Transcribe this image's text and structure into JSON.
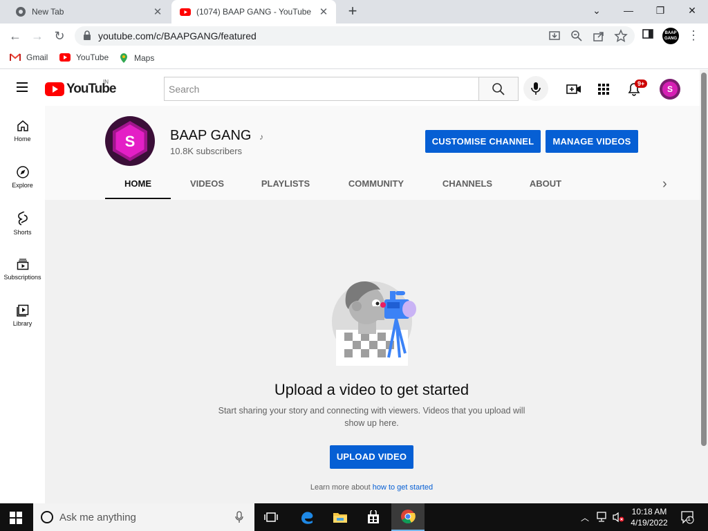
{
  "browser": {
    "tabs": [
      {
        "title": "New Tab",
        "active": false
      },
      {
        "title": "(1074) BAAP GANG - YouTube",
        "active": true
      }
    ],
    "url": "youtube.com/c/BAAPGANG/featured",
    "bookmarks": [
      {
        "label": "Gmail"
      },
      {
        "label": "YouTube"
      },
      {
        "label": "Maps"
      }
    ],
    "profile_text": "BAAP GANG"
  },
  "youtube": {
    "logo_text": "YouTube",
    "region": "IN",
    "search_placeholder": "Search",
    "notification_count": "9+",
    "account_initial": "S",
    "guide": [
      {
        "label": "Home"
      },
      {
        "label": "Explore"
      },
      {
        "label": "Shorts"
      },
      {
        "label": "Subscriptions"
      },
      {
        "label": "Library"
      }
    ],
    "channel": {
      "avatar_letter": "S",
      "name": "BAAP GANG",
      "subscribers": "10.8K subscribers",
      "customise_label": "CUSTOMISE CHANNEL",
      "manage_label": "MANAGE VIDEOS",
      "tabs": [
        "HOME",
        "VIDEOS",
        "PLAYLISTS",
        "COMMUNITY",
        "CHANNELS",
        "ABOUT"
      ],
      "active_tab": "HOME"
    },
    "empty_state": {
      "title": "Upload a video to get started",
      "description": "Start sharing your story and connecting with viewers. Videos that you upload will show up here.",
      "upload_label": "UPLOAD VIDEO",
      "learn_prefix": "Learn more about ",
      "learn_link": "how to get started"
    }
  },
  "taskbar": {
    "search_placeholder": "Ask me anything",
    "time": "10:18 AM",
    "date": "4/19/2022",
    "notification_count": "1"
  },
  "colors": {
    "youtube_red": "#ff0000",
    "button_blue": "#065fd4",
    "avatar_magenta": "#d61fb4"
  }
}
